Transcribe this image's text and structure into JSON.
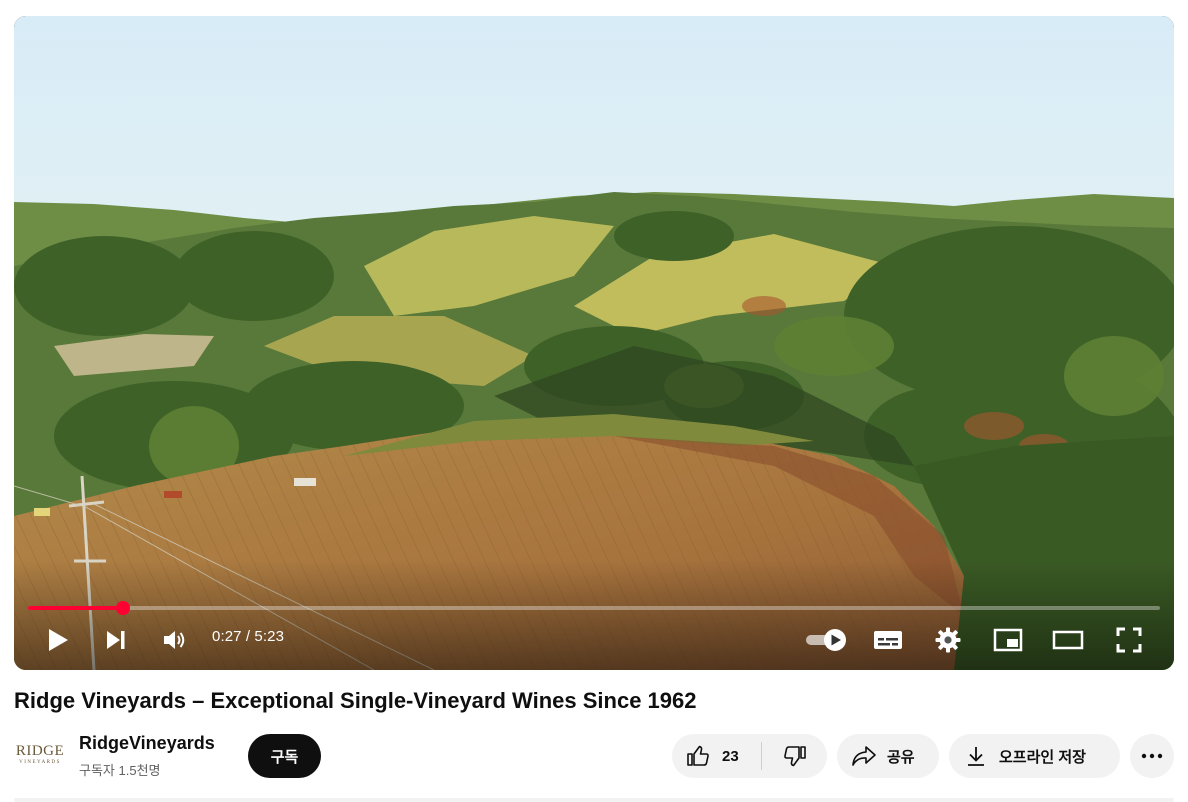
{
  "player": {
    "current_time": "0:27",
    "duration": "5:23",
    "time_separator": " / ",
    "progress_fraction": 0.084,
    "progress_color": "#ff0033"
  },
  "icons": {
    "play": "play-icon",
    "next": "next-icon",
    "volume": "volume-icon",
    "autoplay": "autoplay-toggle-icon",
    "subtitles": "subtitles-icon",
    "settings": "gear-icon",
    "miniplayer": "miniplayer-icon",
    "theater": "theater-mode-icon",
    "fullscreen": "fullscreen-icon",
    "like": "thumbs-up-icon",
    "dislike": "thumbs-down-icon",
    "share": "share-icon",
    "download": "download-icon",
    "more": "more-horizontal-icon"
  },
  "video": {
    "title": "Ridge Vineyards – Exceptional Single-Vineyard Wines Since 1962"
  },
  "channel": {
    "logo_text_main": "RIDGE",
    "logo_text_sub": "VINEYARDS",
    "name": "RidgeVineyards",
    "subscribers": "구독자 1.5천명"
  },
  "actions": {
    "subscribe_label": "구독",
    "like_count": "23",
    "share_label": "공유",
    "download_label": "오프라인 저장"
  }
}
